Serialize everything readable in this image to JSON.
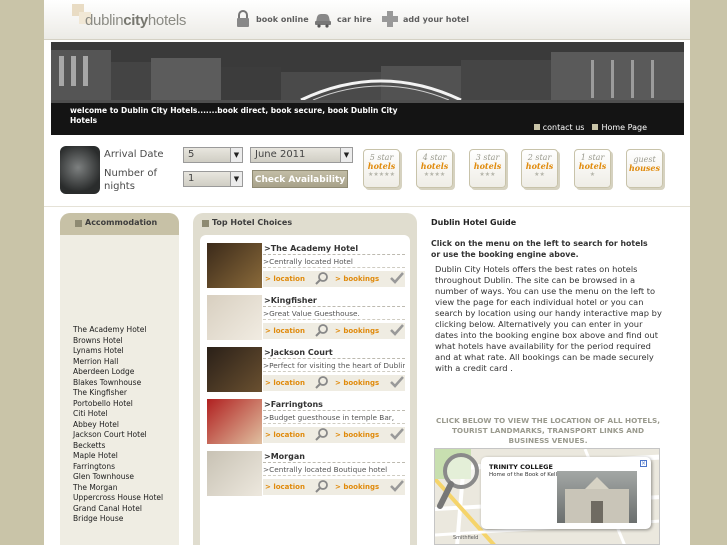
{
  "header": {
    "logo_parts": [
      "dublin",
      "city",
      "hotels"
    ],
    "nav": [
      {
        "label": "book online",
        "icon": "lock-icon"
      },
      {
        "label": "car hire",
        "icon": "car-icon"
      },
      {
        "label": "add your hotel",
        "icon": "plus-icon"
      }
    ]
  },
  "banner": {
    "caption": "welcome to Dublin City Hotels.......book direct, book secure, book Dublin City Hotels",
    "links": [
      "contact us",
      "Home Page"
    ]
  },
  "booking": {
    "arrival_label": "Arrival Date",
    "nights_label": "Number of nights",
    "day_value": "5",
    "month_value": "June 2011",
    "nights_value": "1",
    "check_button": "Check Availability",
    "star_tabs": [
      {
        "num": "5 star",
        "word": "hotels",
        "stars": "★★★★★"
      },
      {
        "num": "4 star",
        "word": "hotels",
        "stars": "★★★★"
      },
      {
        "num": "3 star",
        "word": "hotels",
        "stars": "★★★"
      },
      {
        "num": "2 star",
        "word": "hotels",
        "stars": "★★"
      },
      {
        "num": "1 star",
        "word": "hotels",
        "stars": "★"
      },
      {
        "num": "guest",
        "word": "houses",
        "stars": ""
      }
    ]
  },
  "sidebar": {
    "title": "Accommodation",
    "items": [
      "The Academy Hotel",
      "Browns Hotel",
      "Lynams Hotel",
      "Merrion Hall",
      "Aberdeen Lodge",
      "Blakes Townhouse",
      "The Kingfisher",
      "Portobello Hotel",
      "Citi Hotel",
      "Abbey Hotel",
      "Jackson Court Hotel",
      "Becketts",
      "Maple Hotel",
      "Farringtons",
      "Glen Townhouse",
      "The Morgan",
      "Uppercross House Hotel",
      "Grand Canal Hotel",
      "Bridge House"
    ]
  },
  "top_hotels": {
    "title": "Top Hotel Choices",
    "location_label": "location",
    "bookings_label": "bookings",
    "hotels": [
      {
        "name": ">The Academy Hotel",
        "desc": ">Centrally located Hotel"
      },
      {
        "name": ">Kingfisher",
        "desc": ">Great Value Guesthouse."
      },
      {
        "name": ">Jackson Court",
        "desc": ">Perfect for visiting the heart of Dublin"
      },
      {
        "name": ">Farringtons",
        "desc": ">Budget guesthouse in temple Bar,"
      },
      {
        "name": ">Morgan",
        "desc": ">Centrally located Boutique hotel"
      }
    ]
  },
  "guide": {
    "title": "Dublin Hotel Guide",
    "subtitle": "Click on the menu on the left to search for hotels or use the booking engine above.",
    "body": "Dublin City Hotels offers the best rates on hotels throughout Dublin. The site can be browsed in a number of ways. You can use the menu on the left to view the page for each individual hotel or you can search by location using our handy interactive map by clicking below. Alternatively you can enter in your dates into the booking engine box above and find out what hotels have availability for the period required and at what rate. All bookings can be made securely with a credit card .",
    "map_caption": "CLICK BELOW TO VIEW THE LOCATION OF ALL HOTELS, TOURIST LANDMARKS, TRANSPORT LINKS AND BUSINESS VENUES.",
    "map_popup_title": "TRINITY COLLEGE",
    "map_popup_sub": "Home of the Book of Kells",
    "map_road_labels": [
      "Smithfield"
    ]
  },
  "colors": {
    "accent_orange": "#e08a0b",
    "page_bg": "#c9c4a8",
    "panel_tan": "#c7c1a6"
  }
}
